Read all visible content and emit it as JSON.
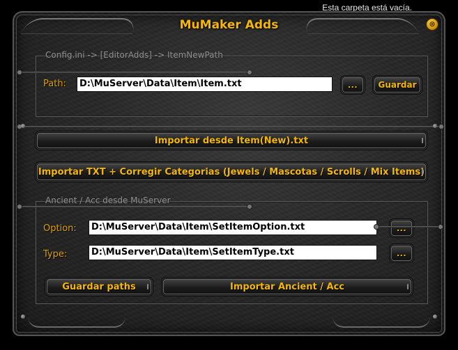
{
  "os_message": "Esta carpeta está vacía.",
  "window": {
    "title": "MuMaker Adds",
    "close_symbol": "⊗"
  },
  "config_group": {
    "legend": "Config.ini  ->  [EditorAdds]  ->  ItemNewPath",
    "path_label": "Path:",
    "path_value": "D:\\MuServer\\Data\\Item\\Item.txt",
    "browse_label": "...",
    "save_label": "Guardar"
  },
  "actions": {
    "import_new_label": "Importar desde Item(New).txt",
    "import_fix_label": "Importar TXT + Corregir Categorias (Jewels / Mascotas / Scrolls / Mix Items)"
  },
  "ancient_group": {
    "legend": "Ancient / Acc desde MuServer",
    "option_label": "Option:",
    "option_value": "D:\\MuServer\\Data\\Item\\SetItemOption.txt",
    "option_browse_label": "...",
    "type_label": "Type:",
    "type_value": "D:\\MuServer\\Data\\Item\\SetItemType.txt",
    "type_browse_label": "...",
    "save_paths_label": "Guardar paths",
    "import_ancient_label": "Importar Ancient / Acc"
  },
  "colors": {
    "accent_gold": "#f5b800",
    "label_gold": "#e0a000",
    "window_bg": "#2a2a2a"
  }
}
